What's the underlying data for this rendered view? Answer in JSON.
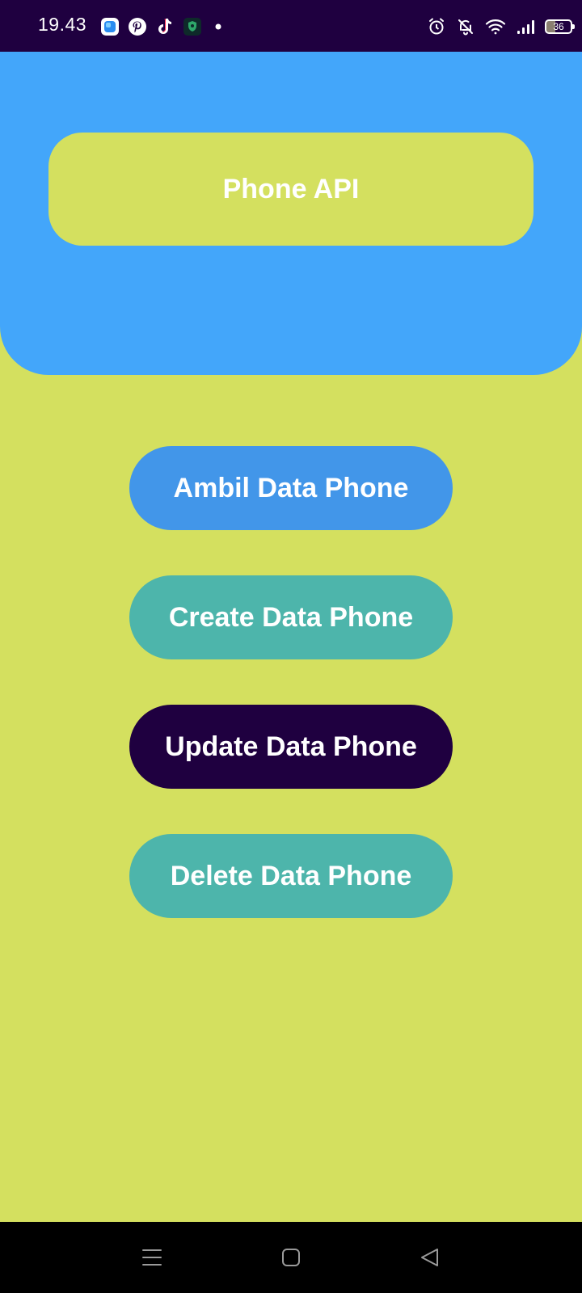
{
  "status_bar": {
    "time": "19.43",
    "battery_level": "36",
    "left_icons": [
      "app-launcher-icon",
      "pinterest-icon",
      "tiktok-icon",
      "shield-app-icon",
      "notification-dot-icon"
    ],
    "right_icons": [
      "alarm-icon",
      "bell-off-icon",
      "wifi-icon",
      "signal-icon",
      "battery-icon"
    ]
  },
  "header": {
    "title": "Phone API"
  },
  "buttons": {
    "ambil": "Ambil Data Phone",
    "create": "Create Data Phone",
    "update": "Update Data Phone",
    "delete": "Delete Data Phone"
  },
  "nav_bar": {
    "icons": [
      "menu-icon",
      "home-icon",
      "back-icon"
    ]
  },
  "colors": {
    "background": "#d4e05f",
    "header": "#43a6fa",
    "status_bar": "#1f0040",
    "ambil_button": "#4296e9",
    "create_button": "#4db5ab",
    "update_button": "#1f0040",
    "delete_button": "#4db5ab"
  }
}
